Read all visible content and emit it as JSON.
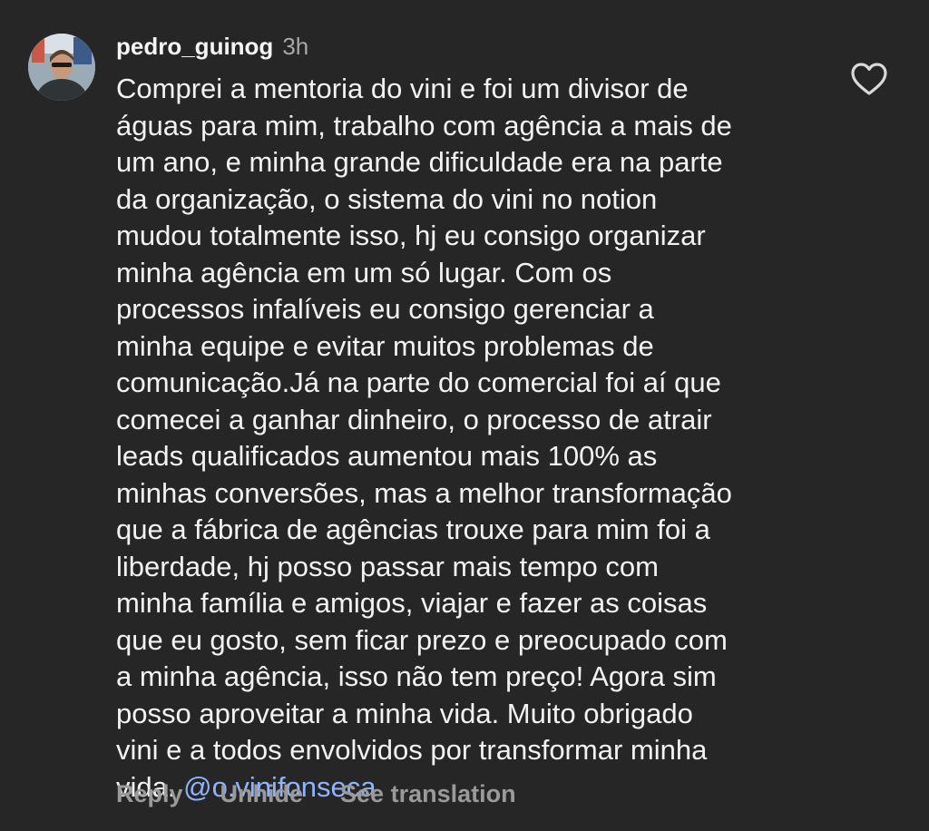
{
  "comment": {
    "username": "pedro_guinog",
    "time": "3h",
    "text": "Comprei a mentoria do vini e foi um divisor de\náguas para mim, trabalho com agência a mais de\num ano, e minha grande dificuldade era na parte\nda organização, o sistema do vini  no notion\nmudou totalmente isso, hj eu consigo organizar\nminha agência em um só lugar. Com os\nprocessos infalíveis eu consigo gerenciar a\nminha equipe e evitar muitos problemas de\ncomunicação.Já na parte do comercial foi aí que\ncomecei a ganhar dinheiro, o processo de atrair\nleads qualificados aumentou mais 100% as\nminhas conversões, mas a melhor transformação\nque a fábrica de agências trouxe para mim foi a\nliberdade, hj posso passar mais tempo com\nminha família e amigos, viajar e fazer as coisas\nque eu gosto, sem ficar prezo e preocupado com\na minha agência, isso não tem preço! Agora sim\nposso aproveitar a minha vida. Muito obrigado\nvini e a todos envolvidos por transformar minha\nvida. ",
    "mention": "@o.vinifonseca",
    "like_icon": "heart-outline-icon",
    "avatar_icon": "profile-photo"
  },
  "actions": {
    "reply": "Reply",
    "unhide": "Unhide",
    "translate": "See translation"
  },
  "colors": {
    "background": "#262626",
    "text": "#f2f2f2",
    "muted": "#a8a8a8",
    "mention": "#8fb3ff"
  }
}
